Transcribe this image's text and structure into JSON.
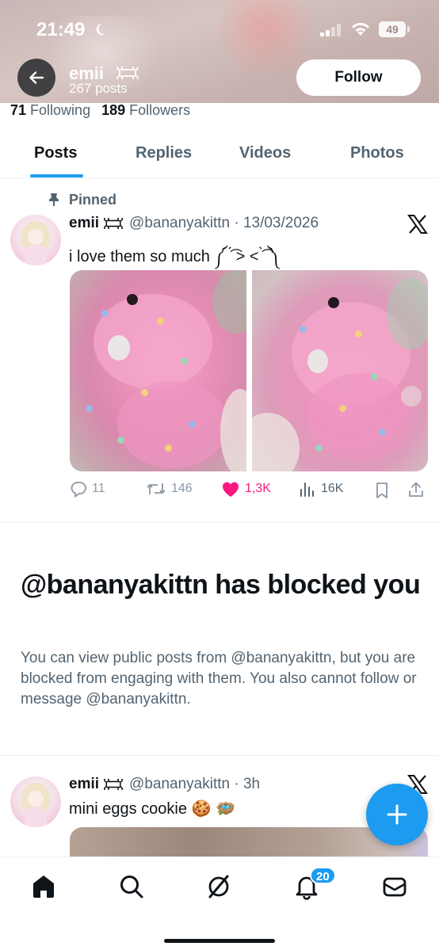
{
  "status_bar": {
    "time": "21:49",
    "battery": "49"
  },
  "header": {
    "name": "emii",
    "post_count": "267 posts",
    "follow_label": "Follow"
  },
  "stats": {
    "following_count": "71",
    "following_label": "Following",
    "followers_count": "189",
    "followers_label": "Followers"
  },
  "tabs": [
    {
      "label": "Posts",
      "active": true
    },
    {
      "label": "Replies",
      "active": false
    },
    {
      "label": "Videos",
      "active": false
    },
    {
      "label": "Photos",
      "active": false
    }
  ],
  "pinned_post": {
    "pinned_label": "Pinned",
    "name": "emii",
    "handle_date": "@bananyakittn · 13/03/2026",
    "text": "i love  them so  much   ༼ ́͡ > < ̀͡ ༽",
    "replies": "11",
    "reposts": "146",
    "likes": "1,3K",
    "views": "16K"
  },
  "blocked": {
    "title": "@bananyakittn has blocked you",
    "body": "You can view public posts from @bananyakittn, but you are blocked from engaging with them. You also cannot follow or message @bananyakittn."
  },
  "second_post": {
    "name": "emii",
    "handle_time": "@bananyakittn · 3h",
    "text": "mini eggs cookie 🍪 🪺"
  },
  "bottom_nav": {
    "notification_count": "20"
  },
  "colors": {
    "accent": "#1d9bf0",
    "like": "#f91880",
    "secondary_text": "#536471",
    "primary_text": "#0f1419"
  },
  "icons": [
    "moon-icon",
    "signal-icon",
    "wifi-icon",
    "battery-icon",
    "back-arrow-icon",
    "bone-icon",
    "pin-icon",
    "x-logo-icon",
    "reply-icon",
    "repost-icon",
    "heart-icon",
    "views-icon",
    "bookmark-icon",
    "share-icon",
    "compose-plus-icon",
    "home-icon",
    "search-icon",
    "grok-icon",
    "bell-icon",
    "mail-icon"
  ]
}
